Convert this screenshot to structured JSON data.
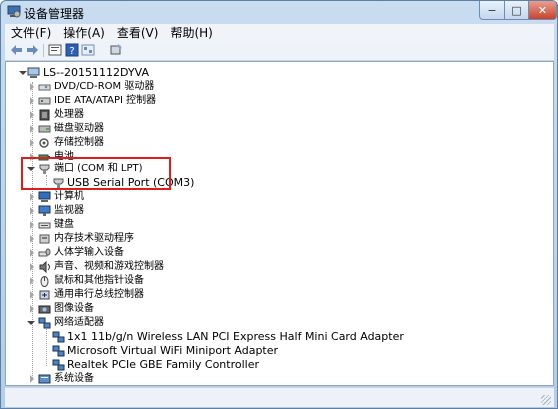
{
  "window": {
    "title": "设备管理器"
  },
  "caption": {
    "minimize": "−",
    "maximize": "□",
    "close": "✕"
  },
  "menu": [
    "文件(F)",
    "操作(A)",
    "查看(V)",
    "帮助(H)"
  ],
  "toolbar": [
    "back-icon",
    "forward-icon",
    "properties-icon",
    "help-icon",
    "driver-icon"
  ],
  "tree": {
    "root": "LS--20151112DYVA",
    "categories": [
      "DVD/CD-ROM 驱动器",
      "IDE ATA/ATAPI 控制器",
      "处理器",
      "磁盘驱动器",
      "存储控制器",
      "电池",
      "端口 (COM 和 LPT)",
      "计算机",
      "监视器",
      "键盘",
      "内存技术驱动程序",
      "人体学输入设备",
      "声音、视频和游戏控制器",
      "鼠标和其他指针设备",
      "通用串行总线控制器",
      "图像设备",
      "网络适配器",
      "系统设备"
    ],
    "ports_children": [
      "USB Serial Port (COM3)"
    ],
    "network_children": [
      "1x1 11b/g/n Wireless LAN PCI Express Half Mini Card Adapter",
      "Microsoft Virtual WiFi Miniport Adapter",
      "Realtek PCIe GBE Family Controller"
    ]
  },
  "colors": {
    "highlight_box": "#e01c1c",
    "titlebar": "#c9dcf0"
  }
}
